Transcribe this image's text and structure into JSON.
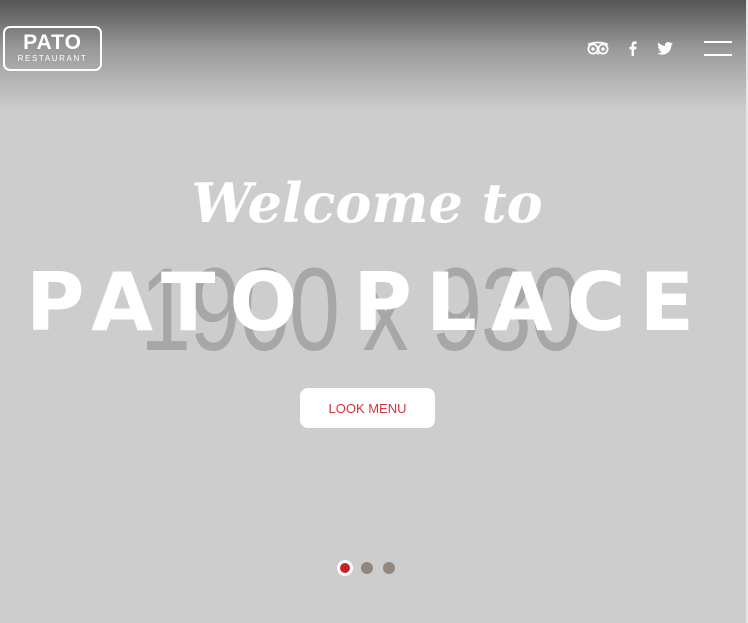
{
  "header": {
    "logo": {
      "name": "PATO",
      "tagline": "RESTAURANT"
    },
    "social_icons": [
      "tripadvisor-icon",
      "facebook-icon",
      "twitter-icon"
    ],
    "menu_icon": "hamburger-icon"
  },
  "hero": {
    "placeholder_size": "1900 x 930",
    "welcome": "Welcome to",
    "headline": "PATO PLACE",
    "button_label": "LOOK MENU"
  },
  "slider": {
    "slide_count": 3,
    "active_index": 0
  },
  "colors": {
    "background": "#cdcdcd",
    "accent": "#c5232c",
    "button_text": "#d3343e",
    "inactive_dot": "#8f8780",
    "placeholder_text": "#a7a7a7"
  }
}
